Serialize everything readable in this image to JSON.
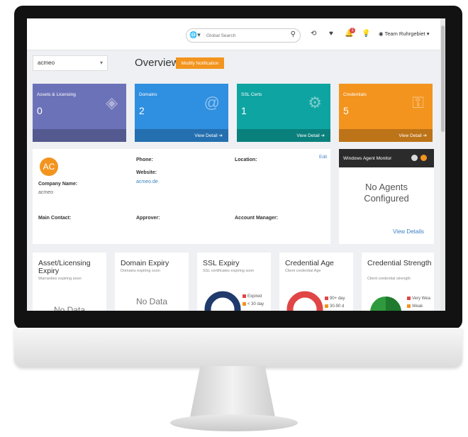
{
  "topbar": {
    "search_placeholder": "Global Search",
    "globe": "🌐▾",
    "search_icon": "⚲",
    "history_icon": "⟲",
    "heart_icon": "♥",
    "bell_icon": "🔔",
    "notification_count": "1",
    "lightbulb_icon": "💡",
    "user_label": "Team Ruhrgebiet ▾"
  },
  "company_select": {
    "value": "acmeo",
    "caret": "▾"
  },
  "page": {
    "title": "Overview",
    "modify_button": "Modify Notification"
  },
  "stats": [
    {
      "label": "Assets & Licensing",
      "value": "0",
      "icon": "◈",
      "footer": "",
      "color": "#6c72b8"
    },
    {
      "label": "Domains",
      "value": "2",
      "icon": "@",
      "footer": "View Detail ➔",
      "color": "#2f8fe0"
    },
    {
      "label": "SSL Certs",
      "value": "1",
      "icon": "⚙",
      "footer": "View Detail ➔",
      "color": "#0ea4a1"
    },
    {
      "label": "Credentials",
      "value": "5",
      "icon": "⚿",
      "footer": "View Detail ➔",
      "color": "#f3941e"
    }
  ],
  "company": {
    "initials": "AC",
    "name_label": "Company Name:",
    "name_value": "acmeo",
    "phone_label": "Phone:",
    "website_label": "Website:",
    "website_value": "acmeo.de",
    "location_label": "Location:",
    "edit": "Edit",
    "main_contact_label": "Main Contact:",
    "approver_label": "Approver:",
    "account_manager_label": "Account Manager:"
  },
  "agent_monitor": {
    "title": "Windows Agent Monitor",
    "empty_line1": "No Agents",
    "empty_line2": "Configured",
    "view_details": "View Details"
  },
  "bottom_cards": [
    {
      "title": "Asset/Licensing Expiry",
      "subtitle": "Warranties expiring soon",
      "nodata": "No Data"
    },
    {
      "title": "Domain Expiry",
      "subtitle": "Domains expiring soon",
      "nodata": "No Data"
    },
    {
      "title": "SSL Expiry",
      "subtitle": "SSL certificates expiring soon",
      "legend": [
        "Expired",
        "< 30 day"
      ]
    },
    {
      "title": "Credential Age",
      "subtitle": "Client credential Age",
      "legend": [
        "90+ day",
        "30-90 d"
      ]
    },
    {
      "title": "Credential Strength",
      "subtitle": "Client credential strength",
      "legend": [
        "Very Wea",
        "Weak"
      ]
    }
  ],
  "colors": {
    "orange": "#f3941e",
    "link": "#3b82c4",
    "donut_navy": "#1f3a6b",
    "donut_red": "#e04646",
    "donut_green": "#2e9a3d"
  }
}
